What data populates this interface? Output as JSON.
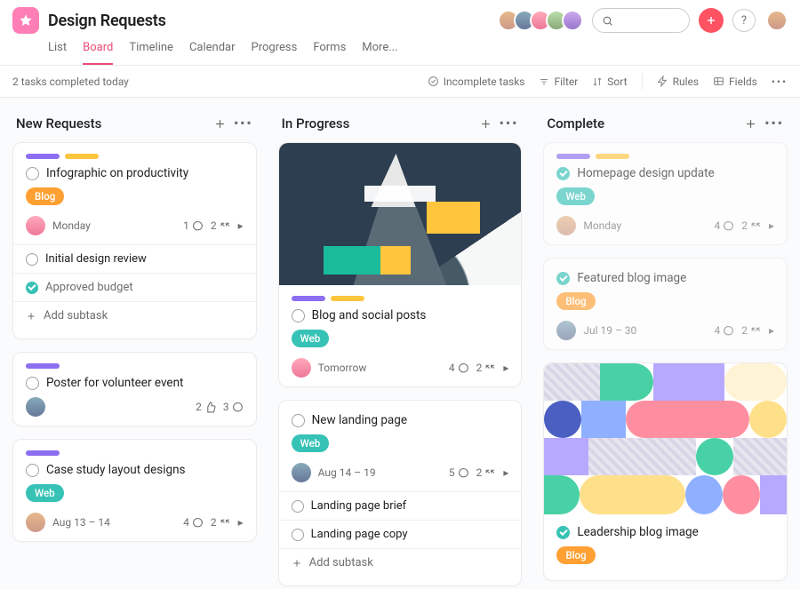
{
  "project": {
    "title": "Design Requests"
  },
  "tabs": [
    "List",
    "Board",
    "Timeline",
    "Calendar",
    "Progress",
    "Forms",
    "More..."
  ],
  "active_tab": 1,
  "toolbar": {
    "status": "2 tasks completed today",
    "incomplete": "Incomplete tasks",
    "filter": "Filter",
    "sort": "Sort",
    "rules": "Rules",
    "fields": "Fields"
  },
  "columns": {
    "new": {
      "title": "New Requests",
      "cards": [
        {
          "pills": [
            "purple",
            "yellow"
          ],
          "title": "Infographic on productivity",
          "tag": {
            "label": "Blog",
            "color": "orange"
          },
          "date": "Monday",
          "comments": 1,
          "subtasks": 2
        },
        {
          "title_row_only": true,
          "title": "Initial design review",
          "subtasks_list": [
            {
              "label": "Approved budget",
              "done": true
            },
            {
              "label": "Add subtask",
              "add": true
            }
          ]
        },
        {
          "pills": [
            "purple"
          ],
          "title": "Poster for volunteer event",
          "likes": 2,
          "comments": 3
        },
        {
          "pills": [
            "purple"
          ],
          "title": "Case study layout designs",
          "tag": {
            "label": "Web",
            "color": "teal"
          },
          "date": "Aug 13 – 14",
          "comments": 4,
          "subtasks": 2
        }
      ]
    },
    "progress": {
      "title": "In Progress",
      "cards": [
        {
          "cover": "mountain",
          "pills": [
            "purple",
            "yellow"
          ],
          "title": "Blog and social posts",
          "tag": {
            "label": "Web",
            "color": "teal"
          },
          "date": "Tomorrow",
          "comments": 4,
          "subtasks": 2
        },
        {
          "title": "New landing page",
          "tag": {
            "label": "Web",
            "color": "teal"
          },
          "date": "Aug 14 – 19",
          "comments": 5,
          "subtasks": 2,
          "subtasks_list": [
            {
              "label": "Landing page brief"
            },
            {
              "label": "Landing page copy"
            },
            {
              "label": "Add subtask",
              "add": true
            }
          ]
        }
      ]
    },
    "complete": {
      "title": "Complete",
      "cards": [
        {
          "dim": true,
          "pills": [
            "purple",
            "yellow"
          ],
          "done": true,
          "title": "Homepage design update",
          "tag": {
            "label": "Web",
            "color": "teal"
          },
          "date": "Monday",
          "comments": 4,
          "subtasks": 2
        },
        {
          "dim": true,
          "done": true,
          "title": "Featured blog image",
          "tag": {
            "label": "Blog",
            "color": "orange"
          },
          "date": "Jul 19 – 30",
          "comments": 4,
          "subtasks": 2
        },
        {
          "cover": "geo",
          "done": true,
          "title": "Leadership blog image",
          "tag": {
            "label": "Blog",
            "color": "orange"
          }
        }
      ]
    }
  }
}
